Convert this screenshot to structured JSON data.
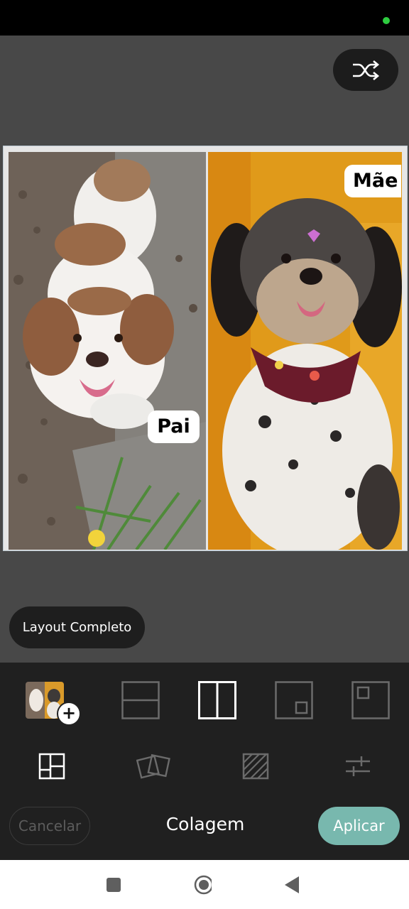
{
  "collage": {
    "left_label": "Pai",
    "right_label": "Mãe"
  },
  "tooltip": {
    "text": "Layout Completo"
  },
  "layouts": {
    "selected": "two-vertical",
    "options": [
      "two-horizontal",
      "two-vertical",
      "small-bottom-right",
      "small-top-left"
    ]
  },
  "tools": [
    "layout-tool",
    "frames-tool",
    "pattern-tool",
    "adjust-tool"
  ],
  "bottom": {
    "cancel_label": "Cancelar",
    "title": "Colagem",
    "apply_label": "Aplicar"
  },
  "colors": {
    "accent": "#78b8ae",
    "panel": "#202020",
    "canvas": "#484848"
  }
}
